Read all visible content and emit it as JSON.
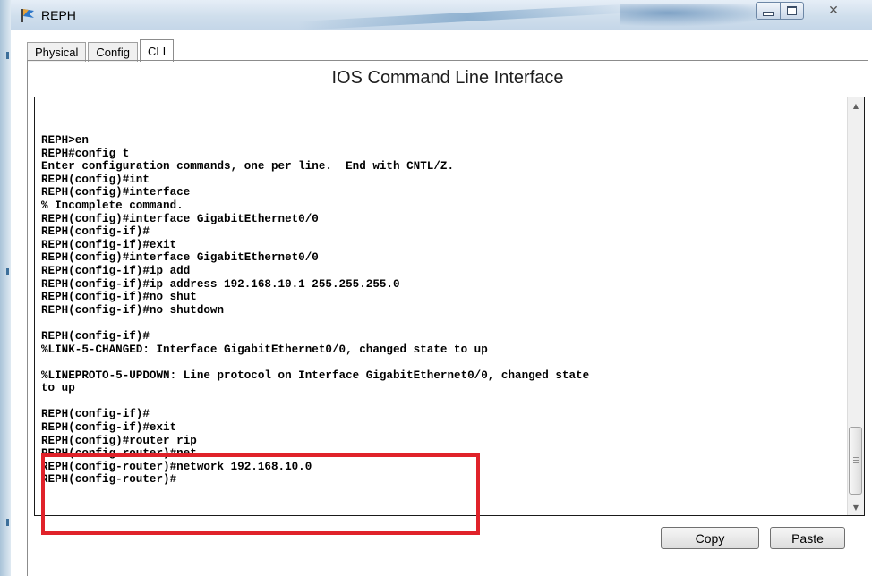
{
  "window": {
    "title": "REPH",
    "icon": "router-flag-icon",
    "close_glyph": "✕"
  },
  "tabs": [
    {
      "label": "Physical",
      "active": false
    },
    {
      "label": "Config",
      "active": false
    },
    {
      "label": "CLI",
      "active": true
    }
  ],
  "cli": {
    "heading": "IOS Command Line Interface",
    "console_lines": [
      "REPH>en",
      "REPH#config t",
      "Enter configuration commands, one per line.  End with CNTL/Z.",
      "REPH(config)#int",
      "REPH(config)#interface",
      "% Incomplete command.",
      "REPH(config)#interface GigabitEthernet0/0",
      "REPH(config-if)#",
      "REPH(config-if)#exit",
      "REPH(config)#interface GigabitEthernet0/0",
      "REPH(config-if)#ip add",
      "REPH(config-if)#ip address 192.168.10.1 255.255.255.0",
      "REPH(config-if)#no shut",
      "REPH(config-if)#no shutdown",
      "",
      "REPH(config-if)#",
      "%LINK-5-CHANGED: Interface GigabitEthernet0/0, changed state to up",
      "",
      "%LINEPROTO-5-UPDOWN: Line protocol on Interface GigabitEthernet0/0, changed state",
      "to up",
      "",
      "REPH(config-if)#",
      "REPH(config-if)#exit",
      "REPH(config)#router rip",
      "REPH(config-router)#net",
      "REPH(config-router)#network 192.168.10.0",
      "REPH(config-router)#"
    ],
    "copy_label": "Copy",
    "paste_label": "Paste"
  },
  "annotation": {
    "highlight_color": "#e0222a"
  }
}
